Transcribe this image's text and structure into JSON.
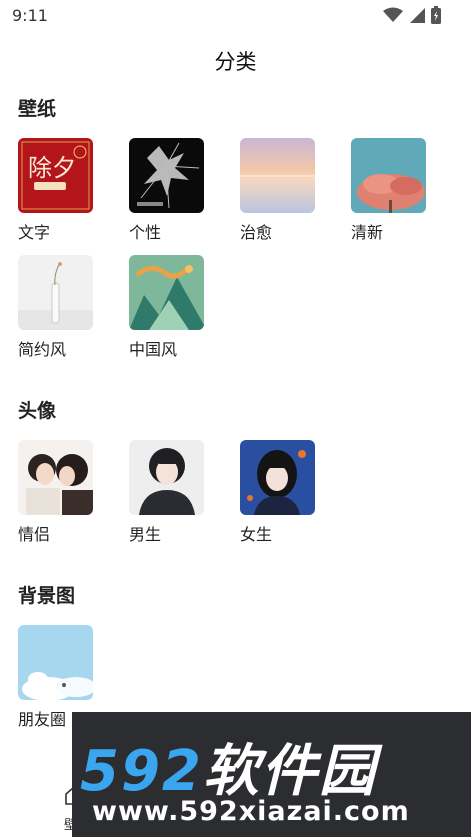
{
  "status_bar": {
    "time": "9:11",
    "icons": [
      "wifi-icon",
      "signal-icon",
      "battery-icon"
    ]
  },
  "page_title": "分类",
  "sections": [
    {
      "title": "壁纸",
      "items": [
        {
          "label": "文字",
          "thumb_text": "除夕"
        },
        {
          "label": "个性"
        },
        {
          "label": "治愈"
        },
        {
          "label": "清新"
        },
        {
          "label": "简约风"
        },
        {
          "label": "中国风"
        }
      ]
    },
    {
      "title": "头像",
      "items": [
        {
          "label": "情侣"
        },
        {
          "label": "男生"
        },
        {
          "label": "女生"
        }
      ]
    },
    {
      "title": "背景图",
      "items": [
        {
          "label": "朋友圈"
        }
      ]
    }
  ],
  "tabbar": {
    "first_tab_label": "壁"
  },
  "watermark": {
    "brand_num": "592",
    "brand_cn": "软件园",
    "url": "www.592xiazai.com"
  },
  "colors": {
    "accent": "#3ba6f0",
    "watermark_bg": "#2b2d30",
    "title_text": "#222222"
  }
}
